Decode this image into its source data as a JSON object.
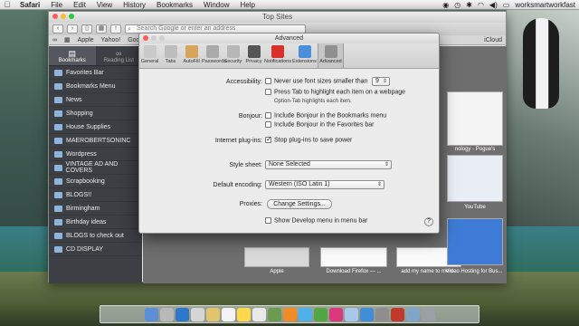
{
  "menubar": {
    "apple": "",
    "items": [
      "Safari",
      "File",
      "Edit",
      "View",
      "History",
      "Bookmarks",
      "Window",
      "Help"
    ],
    "user": "worksmartworkfast"
  },
  "safari": {
    "window_title": "Top Sites",
    "search_placeholder": "Search Google or enter an address",
    "bookmarks_bar": [
      "Apple",
      "Yahoo!",
      "Goo"
    ],
    "bookmarks_bar_right": "iCloud",
    "sidebar_tabs": [
      "Bookmarks",
      "Reading List"
    ],
    "sidebar_items": [
      "Favorites Bar",
      "Bookmarks Menu",
      "News",
      "Shopping",
      "House Supplies",
      "MAEROBERTSONINC",
      "Wordpress",
      "VINTAGE AD AND COVERS",
      "Scrapbooking",
      "BLOGS!!",
      "Birmingham",
      "Birthday ideas",
      "BLOGS to check out",
      "CD DISPLAY"
    ],
    "top_sites_labels": [
      "nology - Pogue's",
      "YouTube",
      "Apple",
      "Download Firefox — ...",
      "add my name to men...",
      "Video Hosting for Bus..."
    ]
  },
  "prefs": {
    "title": "Advanced",
    "tabs": [
      "General",
      "Tabs",
      "AutoFill",
      "Passwords",
      "Security",
      "Privacy",
      "Notifications",
      "Extensions",
      "Advanced"
    ],
    "accessibility_label": "Accessibility:",
    "never_font_text": "Never use font sizes smaller than",
    "font_size_value": "9",
    "press_tab_text": "Press Tab to highlight each item on a webpage",
    "option_tab_text": "Option-Tab highlights each item.",
    "bonjour_label": "Bonjour:",
    "bonjour_bookmarks_menu": "Include Bonjour in the Bookmarks menu",
    "bonjour_favorites_bar": "Include Bonjour in the Favorites bar",
    "plugins_label": "Internet plug-ins:",
    "plugins_text": "Stop plug-ins to save power",
    "stylesheet_label": "Style sheet:",
    "stylesheet_value": "None Selected",
    "encoding_label": "Default encoding:",
    "encoding_value": "Western (ISO Latin 1)",
    "proxies_label": "Proxies:",
    "proxies_button": "Change Settings...",
    "develop_text": "Show Develop menu in menu bar",
    "help": "?"
  },
  "colors": {
    "close": "#ff5f57",
    "minimize": "#febc2e",
    "zoom": "#28c840"
  }
}
